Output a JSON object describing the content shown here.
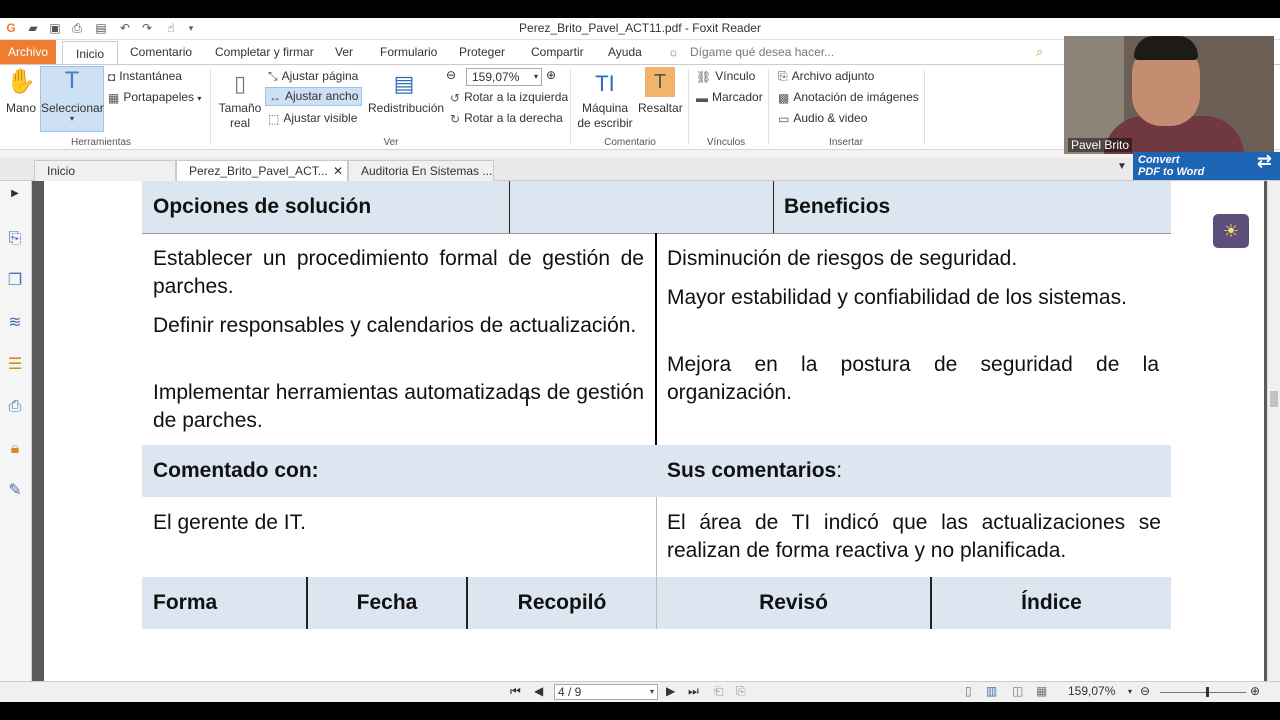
{
  "window": {
    "title": "Perez_Brito_Pavel_ACT11.pdf - Foxit Reader"
  },
  "menu": {
    "file": "Archivo",
    "tabs": [
      "Inicio",
      "Comentario",
      "Completar y firmar",
      "Ver",
      "Formulario",
      "Proteger",
      "Compartir",
      "Ayuda"
    ],
    "tell_me_placeholder": "Dígame qué desea hacer..."
  },
  "ribbon": {
    "hand": "Mano",
    "select": "Seleccionar",
    "snapshot": "Instantánea",
    "clipboard": "Portapapeles",
    "group_tools": "Herramientas",
    "actual_size_1": "Tamaño",
    "actual_size_2": "real",
    "fit_page": "Ajustar página",
    "fit_width": "Ajustar ancho",
    "fit_visible": "Ajustar visible",
    "reflow": "Redistribución",
    "zoom_value": "159,07%",
    "rotate_left": "Rotar a la izquierda",
    "rotate_right": "Rotar a la derecha",
    "group_view": "Ver",
    "typewriter_1": "Máquina",
    "typewriter_2": "de escribir",
    "highlight": "Resaltar",
    "group_comment": "Comentario",
    "link": "Vínculo",
    "bookmark": "Marcador",
    "group_links": "Vínculos",
    "file_attachment": "Archivo adjunto",
    "image_annotation": "Anotación de imágenes",
    "audio_video": "Audio & video",
    "group_insert": "Insertar"
  },
  "doc_tabs": [
    "Inicio",
    "Perez_Brito_Pavel_ACT...",
    "Auditoria En Sistemas ..."
  ],
  "convert": {
    "line1": "Convert",
    "line2": "PDF to Word"
  },
  "webcam": {
    "name": "Pavel Brito"
  },
  "table": {
    "h_options": "Opciones de solución",
    "h_benefits": "Beneficios",
    "options": [
      "Establecer un procedimiento formal de gestión de parches.",
      "Definir responsables y calendarios de actualización.",
      "Implementar herramientas automatizadas de gestión de parches."
    ],
    "benefits": [
      "Disminución de riesgos de seguridad.",
      "Mayor estabilidad y confiabilidad de los sistemas.",
      "Mejora en la postura de seguridad de la organización."
    ],
    "h_commented": "Comentado con:",
    "h_comments": "Sus comentarios",
    "h_comments_colon": ":",
    "commented": "El gerente de IT.",
    "comments": "El área de TI indicó que las actualizaciones se realizan de forma reactiva y no planificada.",
    "footer": [
      "Forma",
      "Fecha",
      "Recopiló",
      "Revisó",
      "Índice"
    ]
  },
  "status": {
    "page": "4 / 9",
    "zoom": "159,07%"
  },
  "colors": {
    "header_fill": "#dce6f1",
    "file_tab": "#ed7d31",
    "convert_bg": "#1e64b4"
  }
}
